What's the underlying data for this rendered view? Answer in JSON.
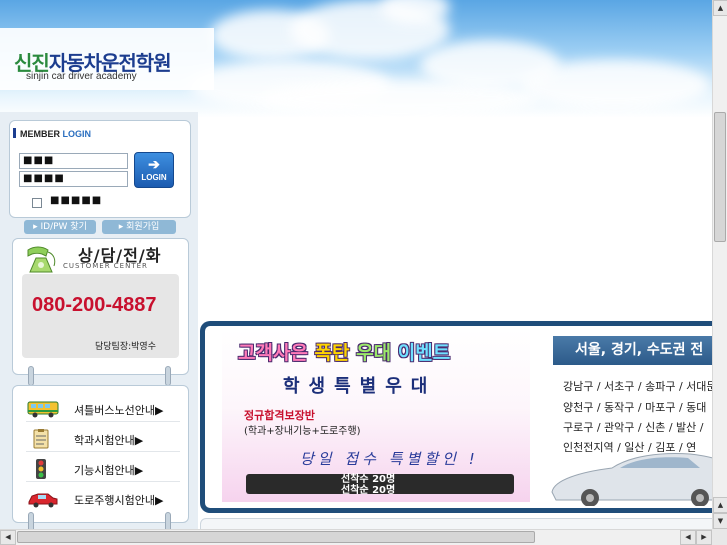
{
  "header": {
    "logo_part1": "신진",
    "logo_part2": "자동차운전학원",
    "logo_sub": "sinjin car driver academy"
  },
  "login": {
    "title_prefix": "MEMBER",
    "title_suffix": "LOGIN",
    "id_value": "■■■",
    "pw_value": "■■■■",
    "button_label": "LOGIN",
    "save_label": "■■■■■",
    "find_label": "▸ ID/PW 찾기",
    "join_label": "▸ 회원가입"
  },
  "contact": {
    "title": "상/담/전/화",
    "subtitle": "CUSTOMER CENTER",
    "phone": "080-200-4887",
    "manager": "담당팀장:박영수"
  },
  "menu": {
    "items": [
      {
        "label": "셔틀버스노선안내▶",
        "icon": "bus-icon"
      },
      {
        "label": "학과시험안내▶",
        "icon": "clipboard-icon"
      },
      {
        "label": "기능시험안내▶",
        "icon": "traffic-light-icon"
      },
      {
        "label": "도로주행시험안내▶",
        "icon": "car-icon"
      }
    ]
  },
  "banner": {
    "headline_1": "고객사은",
    "headline_2": "폭탄",
    "headline_3": "우대",
    "headline_4": "이벤트",
    "student": "학생특별우대",
    "promo_red": "정규합격보장반",
    "promo_sub": "(학과+장내기능+도로주행)",
    "script": "당일 접수 특별할인 !",
    "seat_line1": "선착수 20명",
    "seat_line2": "선착순 20명"
  },
  "region": {
    "title": "서울, 경기, 수도권 전",
    "lines": [
      "강남구 / 서초구 / 송파구 / 서대문",
      "양천구 / 동작구 / 마포구 / 동대",
      "구로구 / 관악구 / 신촌 / 발산 /",
      "인천전지역 / 일산 / 김포 / 연"
    ]
  },
  "colors": {
    "accent_red": "#c8102e",
    "navy": "#1f4d7a",
    "logo_green": "#2b8a3e"
  }
}
